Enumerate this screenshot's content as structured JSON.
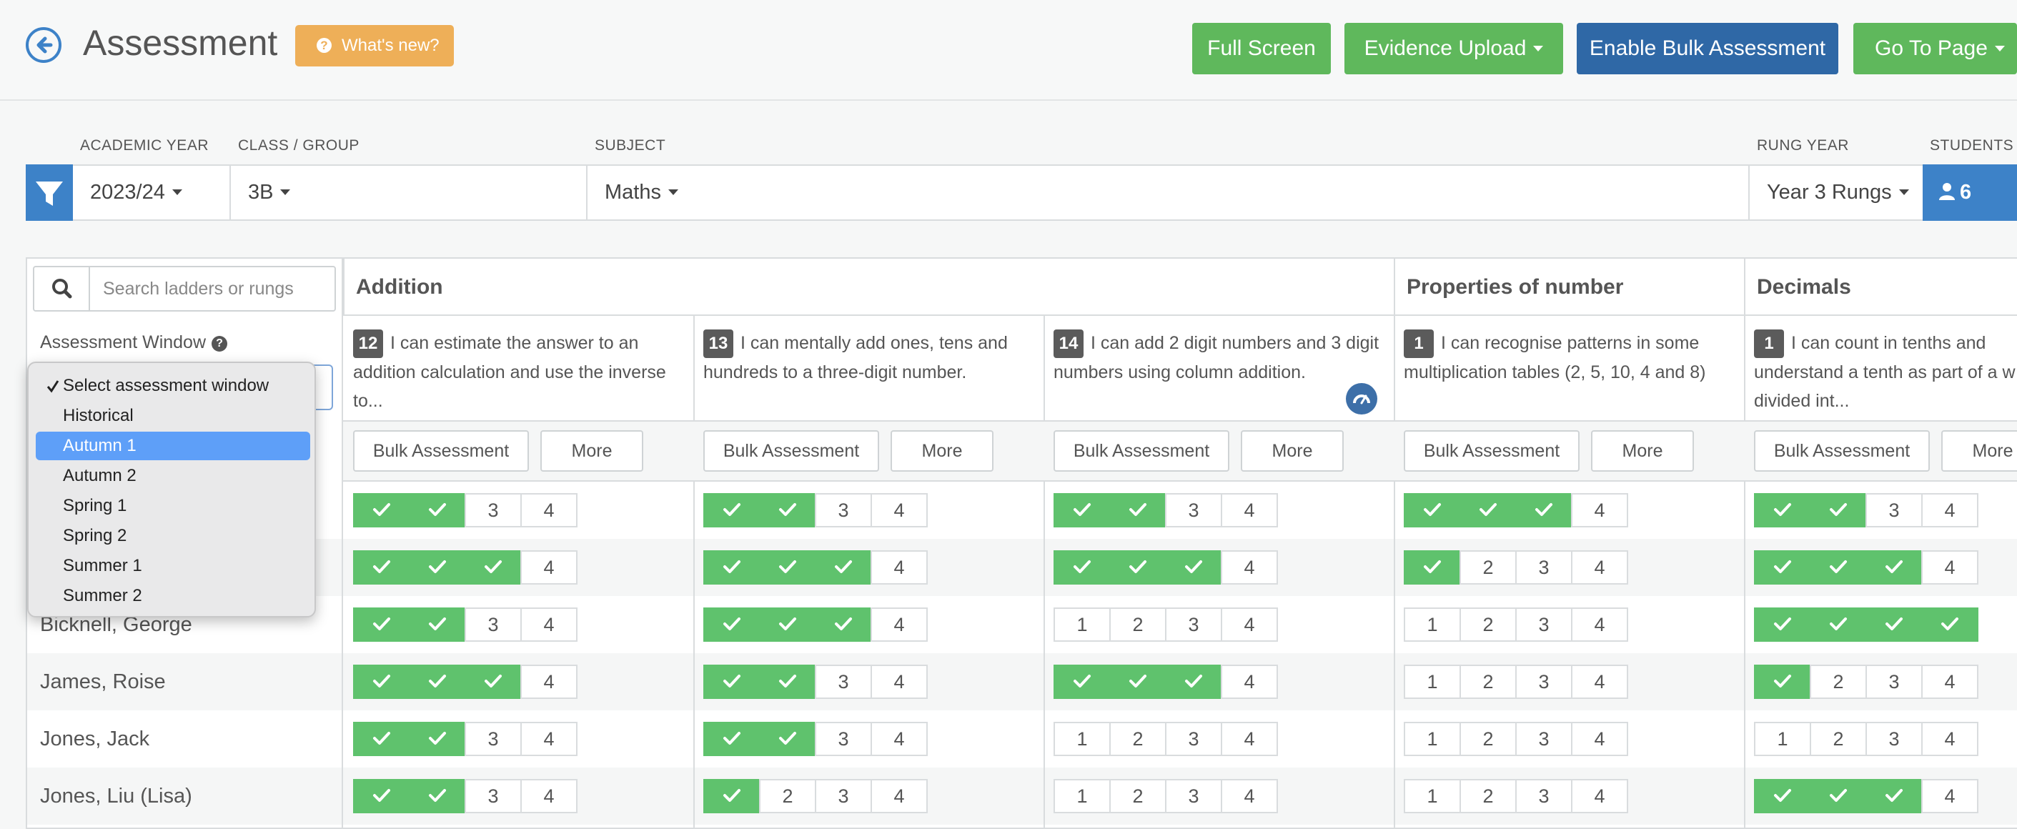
{
  "header": {
    "title": "Assessment",
    "whats_new": "What's new?",
    "buttons": {
      "full_screen": "Full Screen",
      "evidence_upload": "Evidence Upload",
      "enable_bulk": "Enable Bulk Assessment",
      "go_to_page": "Go To Page"
    }
  },
  "filters": {
    "academic_year_label": "ACADEMIC YEAR",
    "academic_year": "2023/24",
    "class_label": "CLASS / GROUP",
    "class": "3B",
    "subject_label": "SUBJECT",
    "subject": "Maths",
    "rung_year_label": "RUNG YEAR",
    "rung_year": "Year 3 Rungs",
    "students_label": "STUDENTS",
    "students_count": "6"
  },
  "search": {
    "placeholder": "Search ladders or rungs"
  },
  "assessment_window": {
    "label": "Assessment Window",
    "options": [
      "Select assessment window",
      "Historical",
      "Autumn 1",
      "Autumn 2",
      "Spring 1",
      "Spring 2",
      "Summer 1",
      "Summer 2"
    ],
    "highlighted": "Autumn 1"
  },
  "ladders": [
    {
      "name": "Addition"
    },
    {
      "name": "Properties of number"
    },
    {
      "name": "Decimals"
    }
  ],
  "rungs": [
    {
      "num": "12",
      "text": "I can estimate the answer to an addition calculation and use the inverse to..."
    },
    {
      "num": "13",
      "text": "I can mentally add ones, tens and hundreds to a three-digit number."
    },
    {
      "num": "14",
      "text": "I can add 2 digit numbers and 3 digit numbers using column addition."
    },
    {
      "num": "1",
      "text": "I can recognise patterns in some multiplication tables (2, 5, 10, 4 and 8)"
    },
    {
      "num": "1",
      "text": "I can count in tenths and understand a tenth as part of a w divided int..."
    }
  ],
  "actions": {
    "bulk": "Bulk Assessment",
    "more": "More"
  },
  "students": [
    "Bicknell, George",
    "James, Roise",
    "Jones, Jack",
    "Jones, Liu (Lisa)"
  ],
  "colors": {
    "accent_blue": "#3d82c8",
    "green": "#5fb85c",
    "check_green": "#5fc26d",
    "orange": "#eeaf58",
    "dark_blue": "#2f68a6"
  }
}
